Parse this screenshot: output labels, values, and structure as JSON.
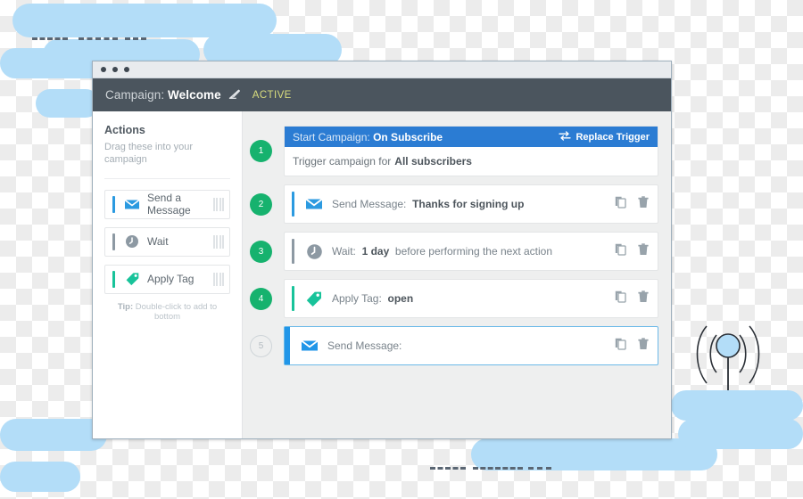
{
  "window": {
    "traffic_dots": 3,
    "header": {
      "label": "Campaign:",
      "name": "Welcome",
      "edit_icon": "pencil-icon",
      "status": "ACTIVE"
    }
  },
  "sidebar": {
    "title": "Actions",
    "subtitle": "Drag these into your campaign",
    "items": [
      {
        "label": "Send a Message",
        "icon": "envelope-icon",
        "accent": "#2b9ae0"
      },
      {
        "label": "Wait",
        "icon": "clock-icon",
        "accent": "#8d99a3"
      },
      {
        "label": "Apply Tag",
        "icon": "tag-icon",
        "accent": "#18c39a"
      }
    ],
    "tip_prefix": "Tip:",
    "tip_text": " Double-click to add to bottom"
  },
  "canvas": {
    "trigger": {
      "badge": "1",
      "title_label": "Start Campaign:",
      "title_value": "On Subscribe",
      "replace_label": "Replace Trigger",
      "replace_icon": "swap-arrows-icon",
      "body_label": "Trigger campaign for",
      "body_value": "All subscribers"
    },
    "steps": [
      {
        "badge": "2",
        "label": "Send Message:",
        "value": "Thanks for signing up",
        "suffix": "",
        "icon": "envelope-icon",
        "accent": "#2b9ae0",
        "selected": false
      },
      {
        "badge": "3",
        "label": "Wait:",
        "value": "1 day",
        "suffix": "before performing the next action",
        "icon": "clock-icon",
        "accent": "#8d99a3",
        "selected": false
      },
      {
        "badge": "4",
        "label": "Apply Tag:",
        "value": "open",
        "suffix": "",
        "icon": "tag-icon",
        "accent": "#18c39a",
        "selected": false
      },
      {
        "badge": "5",
        "label": "Send Message:",
        "value": "",
        "suffix": "",
        "icon": "envelope-icon",
        "accent": "#2196e8",
        "selected": true
      }
    ],
    "row_icons": {
      "duplicate": "copy-icon",
      "delete": "trash-icon"
    }
  },
  "decoration": {
    "cloud_color": "#b3ddf8",
    "dash_color": "#5a6673",
    "antenna_icon": "broadcast-antenna-icon"
  }
}
